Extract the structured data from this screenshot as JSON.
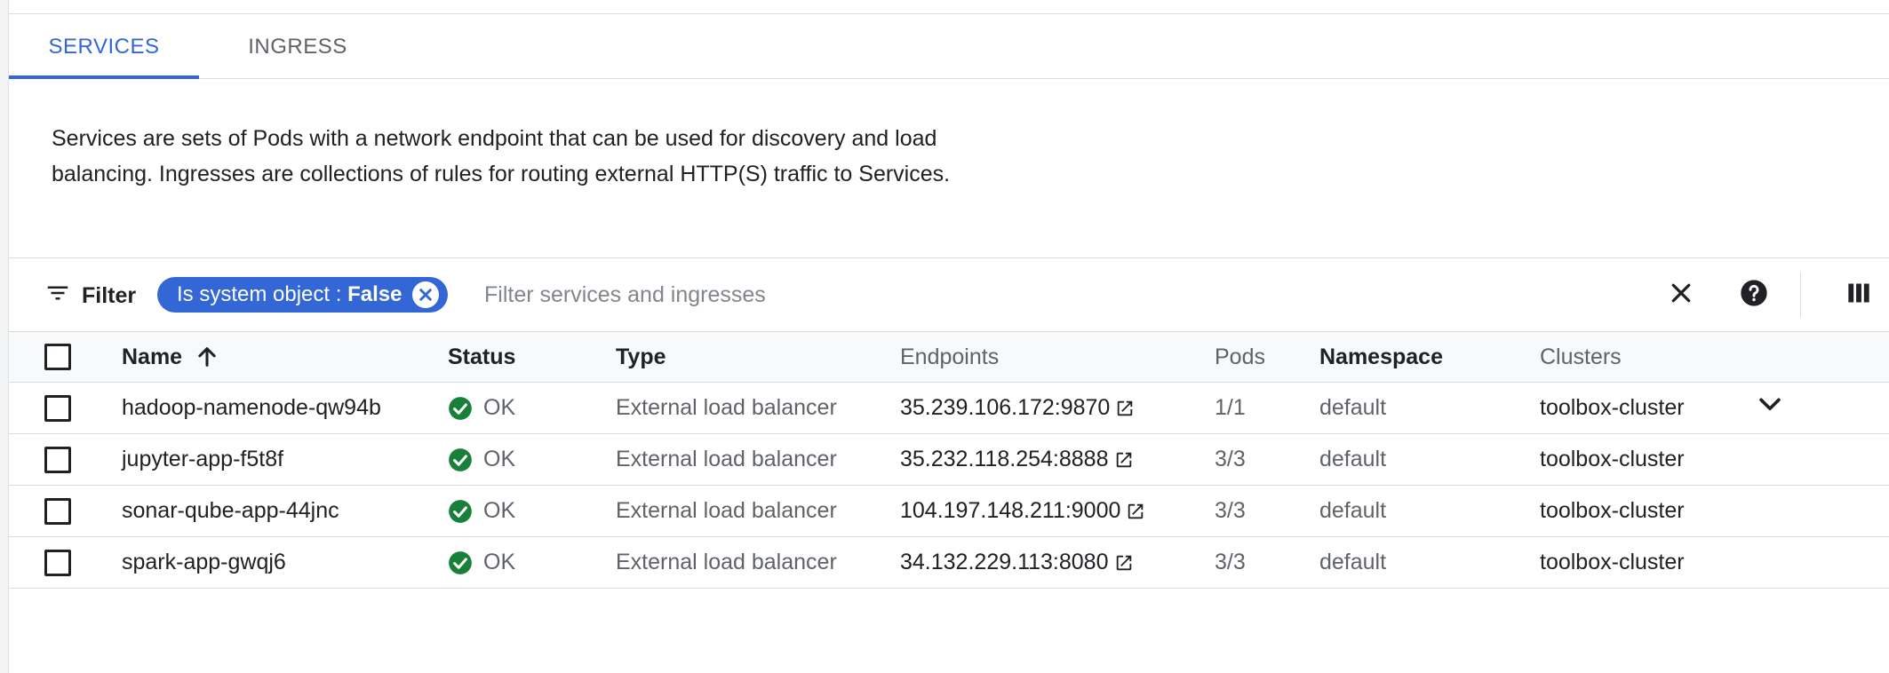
{
  "tabs": [
    {
      "label": "SERVICES",
      "active": true
    },
    {
      "label": "INGRESS",
      "active": false
    }
  ],
  "description": "Services are sets of Pods with a network endpoint that can be used for discovery and load balancing. Ingresses are collections of rules for routing external HTTP(S) traffic to Services.",
  "filter": {
    "label": "Filter",
    "chip_key": "Is system object :",
    "chip_value": "False",
    "placeholder": "Filter services and ingresses"
  },
  "table": {
    "headers": {
      "name": "Name",
      "status": "Status",
      "type": "Type",
      "endpoints": "Endpoints",
      "pods": "Pods",
      "namespace": "Namespace",
      "clusters": "Clusters"
    },
    "rows": [
      {
        "name": "hadoop-namenode-qw94b",
        "status": "OK",
        "type": "External load balancer",
        "endpoint": "35.239.106.172:9870",
        "pods": "1/1",
        "namespace": "default",
        "cluster": "toolbox-cluster"
      },
      {
        "name": "jupyter-app-f5t8f",
        "status": "OK",
        "type": "External load balancer",
        "endpoint": "35.232.118.254:8888",
        "pods": "3/3",
        "namespace": "default",
        "cluster": "toolbox-cluster"
      },
      {
        "name": "sonar-qube-app-44jnc",
        "status": "OK",
        "type": "External load balancer",
        "endpoint": "104.197.148.211:9000",
        "pods": "3/3",
        "namespace": "default",
        "cluster": "toolbox-cluster"
      },
      {
        "name": "spark-app-gwqj6",
        "status": "OK",
        "type": "External load balancer",
        "endpoint": "34.132.229.113:8080",
        "pods": "3/3",
        "namespace": "default",
        "cluster": "toolbox-cluster"
      }
    ]
  },
  "colors": {
    "accent": "#3367d6",
    "ok": "#188038",
    "text": "#202124",
    "muted": "#5f6368"
  },
  "icons": {
    "filter": "filter-list-icon",
    "chip_close": "cancel-icon",
    "clear": "close-icon",
    "help": "help-icon",
    "columns": "view-column-icon",
    "sort": "arrow-upward-icon",
    "status_ok": "check-circle-icon",
    "external": "open-in-new-icon",
    "expand": "chevron-down-icon"
  }
}
